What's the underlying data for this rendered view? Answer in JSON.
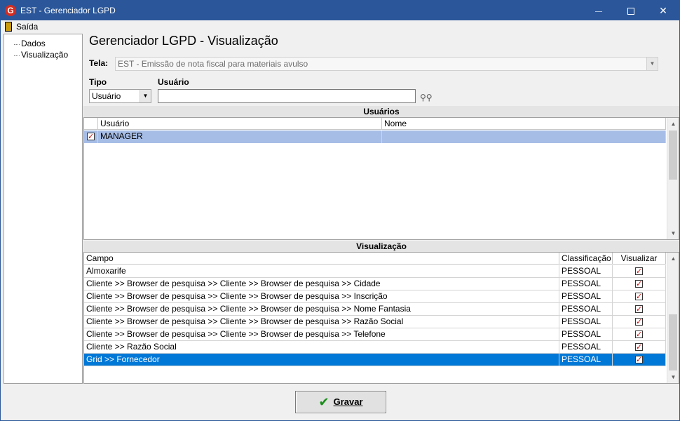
{
  "window": {
    "title": "EST - Gerenciador LGPD",
    "app_icon": "G"
  },
  "menu": {
    "exit_label": "Saída"
  },
  "tree": {
    "items": [
      "Dados",
      "Visualização"
    ]
  },
  "header": {
    "title": "Gerenciador LGPD - Visualização"
  },
  "form": {
    "tela_label": "Tela:",
    "tela_value": "EST - Emissão de nota fiscal para materiais avulso",
    "tipo_label": "Tipo",
    "tipo_value": "Usuário",
    "usuario_label": "Usuário",
    "usuario_value": ""
  },
  "users": {
    "section_title": "Usuários",
    "columns": [
      "Usuário",
      "Nome"
    ],
    "rows": [
      {
        "checked": true,
        "usuario": "MANAGER",
        "nome": ""
      }
    ]
  },
  "visualizacao": {
    "section_title": "Visualização",
    "columns": [
      "Campo",
      "Classificação",
      "Visualizar"
    ],
    "rows": [
      {
        "campo": "Almoxarife",
        "classificacao": "PESSOAL",
        "visualizar": true
      },
      {
        "campo": "Cliente >> Browser de pesquisa >> Cliente >> Browser de pesquisa >> Cidade",
        "classificacao": "PESSOAL",
        "visualizar": true
      },
      {
        "campo": "Cliente >> Browser de pesquisa >> Cliente >> Browser de pesquisa >> Inscrição",
        "classificacao": "PESSOAL",
        "visualizar": true
      },
      {
        "campo": "Cliente >> Browser de pesquisa >> Cliente >> Browser de pesquisa >> Nome Fantasia",
        "classificacao": "PESSOAL",
        "visualizar": true
      },
      {
        "campo": "Cliente >> Browser de pesquisa >> Cliente >> Browser de pesquisa >> Razão Social",
        "classificacao": "PESSOAL",
        "visualizar": true
      },
      {
        "campo": "Cliente >> Browser de pesquisa >> Cliente >> Browser de pesquisa >> Telefone",
        "classificacao": "PESSOAL",
        "visualizar": true
      },
      {
        "campo": "Cliente >> Razão Social",
        "classificacao": "PESSOAL",
        "visualizar": true
      },
      {
        "campo": "Grid >> Fornecedor",
        "classificacao": "PESSOAL",
        "visualizar": true
      }
    ]
  },
  "actions": {
    "save_label": "Gravar"
  },
  "colors": {
    "titlebar": "#2b579a",
    "selected_row": "#0078d7",
    "user_row": "#a6bde6",
    "check": "#d00000"
  }
}
